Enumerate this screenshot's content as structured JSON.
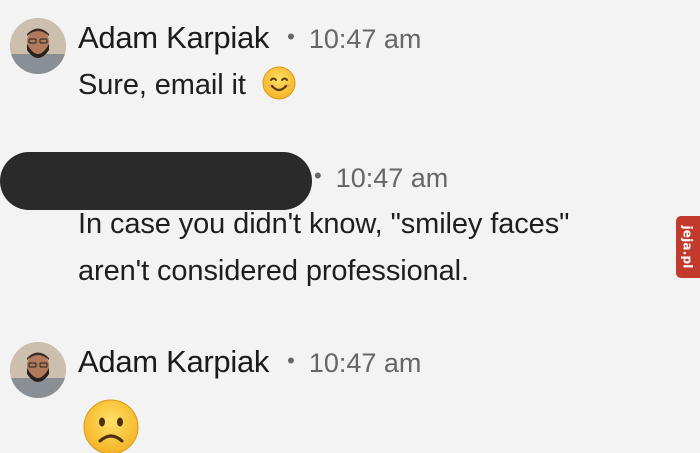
{
  "messages": [
    {
      "sender": "Adam Karpiak",
      "separator": "•",
      "time": "10:47 am",
      "text": "Sure, email it"
    },
    {
      "sender": "",
      "separator": "•",
      "time": "10:47 am",
      "line1": "In case you didn't know, \"smiley faces\"",
      "line2": "aren't considered professional."
    },
    {
      "sender": "Adam Karpiak",
      "separator": "•",
      "time": "10:47 am",
      "text": ""
    }
  ],
  "icons": {
    "smile": "smiling-face-emoji",
    "frown": "frowning-face-emoji",
    "avatar": "avatar"
  },
  "watermark": {
    "text": "jeja.pl",
    "color": "#c23a2c"
  }
}
